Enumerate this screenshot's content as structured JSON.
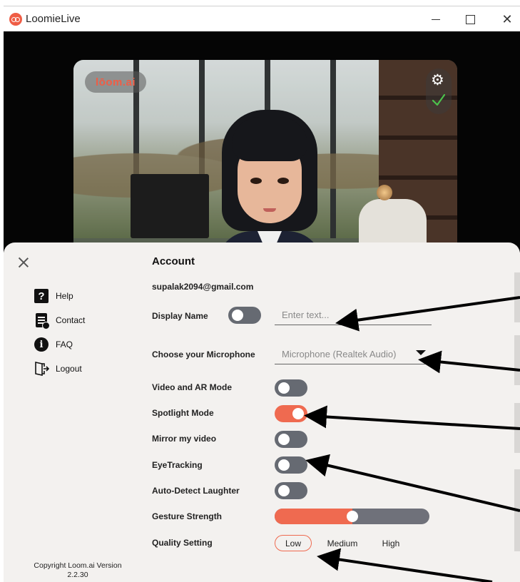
{
  "window": {
    "title": "LoomieLive",
    "min_label": "—",
    "close_label": "✕"
  },
  "video": {
    "brand_label": "lōom.ai",
    "gear_glyph": "⚙"
  },
  "sidebar": {
    "items": [
      {
        "label": "Help",
        "icon": "help-icon"
      },
      {
        "label": "Contact",
        "icon": "contact-icon"
      },
      {
        "label": "FAQ",
        "icon": "faq-icon"
      },
      {
        "label": "Logout",
        "icon": "logout-icon"
      }
    ],
    "help_glyph": "?",
    "faq_glyph": "i",
    "copyright": "Copyright Loom.ai Version 2.2.30"
  },
  "account": {
    "title": "Account",
    "email": "supalak2094@gmail.com",
    "display_name_label": "Display Name",
    "display_name_placeholder": "Enter text...",
    "display_name_toggle": false,
    "microphone_label": "Choose your Microphone",
    "microphone_value": "Microphone (Realtek Audio)",
    "video_ar_label": "Video and AR Mode",
    "video_ar_on": false,
    "spotlight_label": "Spotlight Mode",
    "spotlight_on": true,
    "mirror_label": "Mirror my video",
    "mirror_on": false,
    "eyetracking_label": "EyeTracking",
    "eyetracking_on": false,
    "laughter_label": "Auto-Detect Laughter",
    "laughter_on": false,
    "gesture_label": "Gesture Strength",
    "gesture_value": 0.5,
    "quality_label": "Quality Setting",
    "quality_options": [
      "Low",
      "Medium",
      "High"
    ],
    "quality_selected": "Low"
  },
  "colors": {
    "accent": "#ef6a50",
    "toggle_off": "#666a72",
    "panel_bg": "#f3f1ef"
  }
}
